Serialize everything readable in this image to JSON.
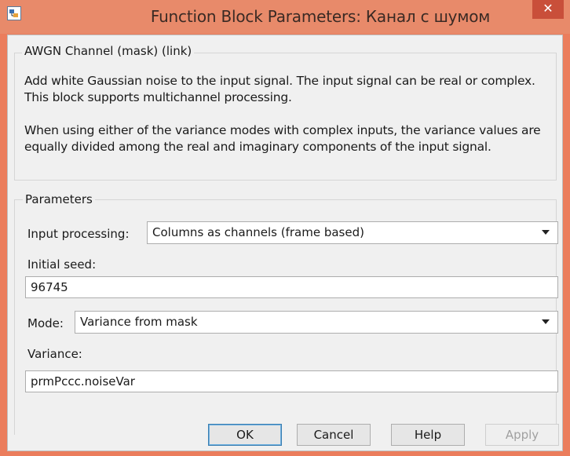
{
  "window": {
    "title": "Function Block Parameters: Канал с шумом",
    "close_label": "✕",
    "icon": "simulink-app-icon"
  },
  "mask": {
    "group_title": "AWGN Channel (mask) (link)",
    "description_1": "Add white Gaussian noise to the input signal. The input signal can be real or complex. This block supports multichannel processing.",
    "description_2": "When using either of the variance modes with complex inputs, the variance values are equally divided among the real and imaginary components of the input signal."
  },
  "parameters": {
    "group_title": "Parameters",
    "input_processing": {
      "label": "Input processing:",
      "value": "Columns as channels (frame based)"
    },
    "initial_seed": {
      "label": "Initial seed:",
      "value": "96745"
    },
    "mode": {
      "label": "Mode:",
      "value": "Variance from mask"
    },
    "variance": {
      "label": "Variance:",
      "value": "prmPccc.noiseVar"
    }
  },
  "buttons": {
    "ok": "OK",
    "cancel": "Cancel",
    "help": "Help",
    "apply": "Apply"
  },
  "colors": {
    "titlebar": "#e88a6a",
    "close": "#c94f3a",
    "dialog_bg": "#f0f0f0"
  }
}
